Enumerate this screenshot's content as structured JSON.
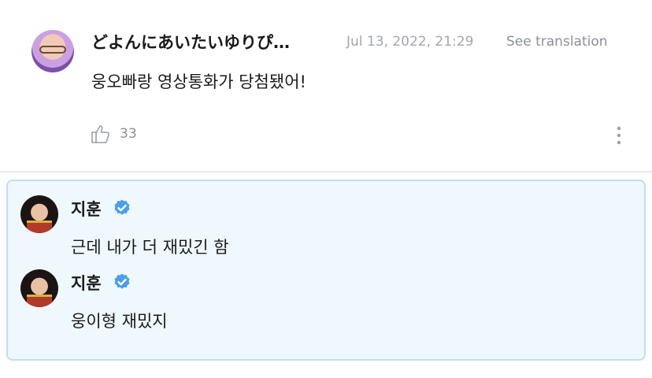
{
  "comment": {
    "author": "どよんにあいたいゆりぴ…",
    "date": "Jul 13, 2022, 21:29",
    "translate_label": "See translation",
    "text": "웅오빠랑 영상통화가 당첨됐어!",
    "like_count": "33"
  },
  "replies": [
    {
      "author": "지훈",
      "text": "근데 내가 더 재밌긴 함"
    },
    {
      "author": "지훈",
      "text": "웅이형 재밌지"
    }
  ],
  "colors": {
    "verified": "#4a9fe8",
    "reply_background": "#eef8fd",
    "reply_border": "#bfe0f0",
    "muted_text": "#8a9097"
  }
}
